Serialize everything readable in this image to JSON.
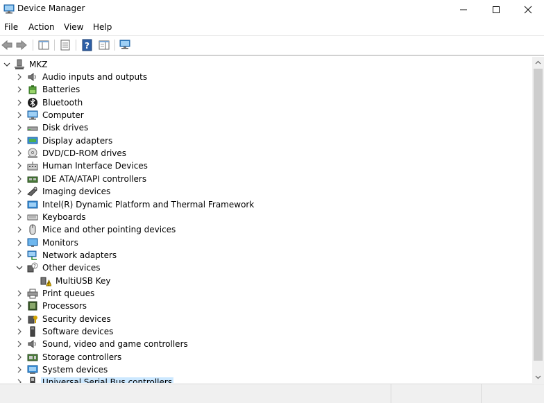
{
  "window": {
    "title": "Device Manager",
    "minimize": "—",
    "maximize": "☐",
    "close": "✕"
  },
  "menu": [
    "File",
    "Action",
    "View",
    "Help"
  ],
  "tree": {
    "root": "MKZ",
    "categories": [
      {
        "label": "Audio inputs and outputs",
        "icon": "speaker-icon",
        "expanded": false
      },
      {
        "label": "Batteries",
        "icon": "battery-icon",
        "expanded": false
      },
      {
        "label": "Bluetooth",
        "icon": "bluetooth-icon",
        "expanded": false
      },
      {
        "label": "Computer",
        "icon": "computer-icon",
        "expanded": false
      },
      {
        "label": "Disk drives",
        "icon": "disk-drive-icon",
        "expanded": false
      },
      {
        "label": "Display adapters",
        "icon": "display-adapter-icon",
        "expanded": false
      },
      {
        "label": "DVD/CD-ROM drives",
        "icon": "dvd-drive-icon",
        "expanded": false
      },
      {
        "label": "Human Interface Devices",
        "icon": "hid-icon",
        "expanded": false
      },
      {
        "label": "IDE ATA/ATAPI controllers",
        "icon": "ide-controller-icon",
        "expanded": false
      },
      {
        "label": "Imaging devices",
        "icon": "camera-icon",
        "expanded": false
      },
      {
        "label": "Intel(R) Dynamic Platform and Thermal Framework",
        "icon": "platform-icon",
        "expanded": false
      },
      {
        "label": "Keyboards",
        "icon": "keyboard-icon",
        "expanded": false
      },
      {
        "label": "Mice and other pointing devices",
        "icon": "mouse-icon",
        "expanded": false
      },
      {
        "label": "Monitors",
        "icon": "monitor-icon",
        "expanded": false
      },
      {
        "label": "Network adapters",
        "icon": "network-adapter-icon",
        "expanded": false
      },
      {
        "label": "Other devices",
        "icon": "unknown-device-icon",
        "expanded": true
      },
      {
        "label": "MultiUSB Key",
        "icon": "warning-device-icon",
        "child": true
      },
      {
        "label": "Print queues",
        "icon": "printer-icon",
        "expanded": false
      },
      {
        "label": "Processors",
        "icon": "processor-icon",
        "expanded": false
      },
      {
        "label": "Security devices",
        "icon": "security-device-icon",
        "expanded": false
      },
      {
        "label": "Software devices",
        "icon": "software-device-icon",
        "expanded": false
      },
      {
        "label": "Sound, video and game controllers",
        "icon": "sound-controller-icon",
        "expanded": false
      },
      {
        "label": "Storage controllers",
        "icon": "storage-controller-icon",
        "expanded": false
      },
      {
        "label": "System devices",
        "icon": "system-device-icon",
        "expanded": false
      },
      {
        "label": "Universal Serial Bus controllers",
        "icon": "usb-icon",
        "expanded": false,
        "selected": true
      }
    ]
  },
  "colors": {
    "selection": "#cce8ff",
    "accent": "#1e7fd6"
  }
}
